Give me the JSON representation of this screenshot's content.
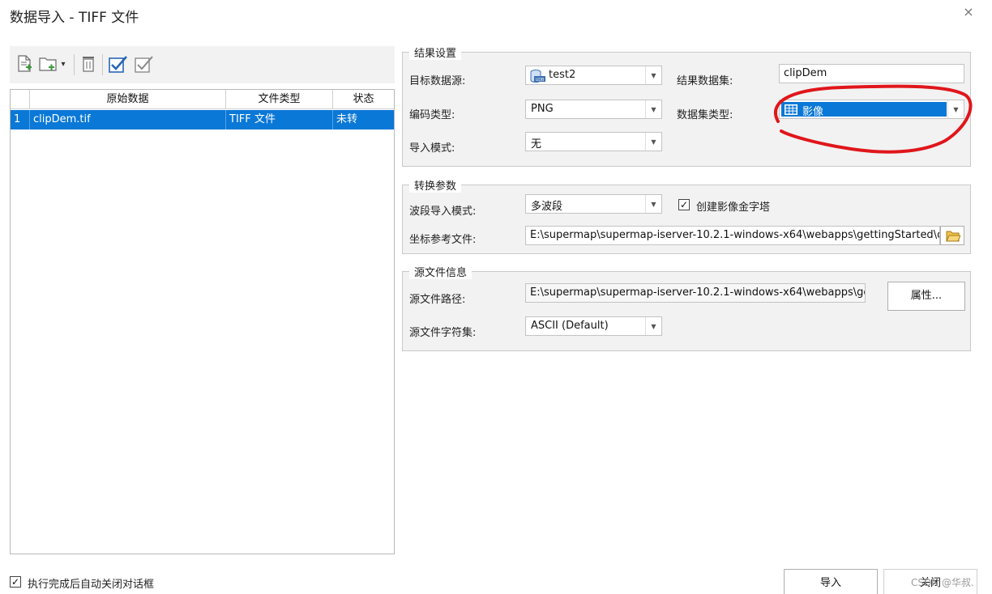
{
  "window": {
    "title": "数据导入 - TIFF 文件",
    "close_glyph": "×"
  },
  "toolbar": {
    "icons": [
      "add-file-icon",
      "add-folder-icon",
      "dropdown-arrow-icon",
      "delete-icon",
      "select-all-icon",
      "invert-select-icon"
    ],
    "dropdown_glyph": "▾"
  },
  "file_table": {
    "headers": [
      "原始数据",
      "文件类型",
      "状态"
    ],
    "rows": [
      {
        "index": "1",
        "name": "clipDem.tif",
        "type": "TIFF 文件",
        "status": "未转"
      }
    ]
  },
  "result_settings": {
    "title": "结果设置",
    "target_datasource_label": "目标数据源:",
    "target_datasource_value": "test2",
    "result_dataset_label": "结果数据集:",
    "result_dataset_value": "clipDem",
    "encoding_label": "编码类型:",
    "encoding_value": "PNG",
    "dataset_type_label": "数据集类型:",
    "dataset_type_value": "影像",
    "import_mode_label": "导入模式:",
    "import_mode_value": "无"
  },
  "convert_params": {
    "title": "转换参数",
    "band_mode_label": "波段导入模式:",
    "band_mode_value": "多波段",
    "pyramid_label": "创建影像金字塔",
    "pyramid_checked": true,
    "coord_ref_label": "坐标参考文件:",
    "coord_ref_value": "E:\\supermap\\supermap-iserver-10.2.1-windows-x64\\webapps\\gettingStarted\\data\\de"
  },
  "source_info": {
    "title": "源文件信息",
    "path_label": "源文件路径:",
    "path_value": "E:\\supermap\\supermap-iserver-10.2.1-windows-x64\\webapps\\gettingS",
    "properties_button": "属性...",
    "charset_label": "源文件字符集:",
    "charset_value": "ASCII (Default)"
  },
  "footer": {
    "auto_close_label": "执行完成后自动关闭对话框",
    "auto_close_checked": true,
    "import_button": "导入",
    "close_button": "关闭",
    "watermark": "CSDN @华叔."
  },
  "colors": {
    "selection": "#0a78d7",
    "annotation": "#e0161b",
    "panel": "#f2f2f2"
  },
  "glyphs": {
    "arrow": "▼",
    "check": "✓"
  }
}
